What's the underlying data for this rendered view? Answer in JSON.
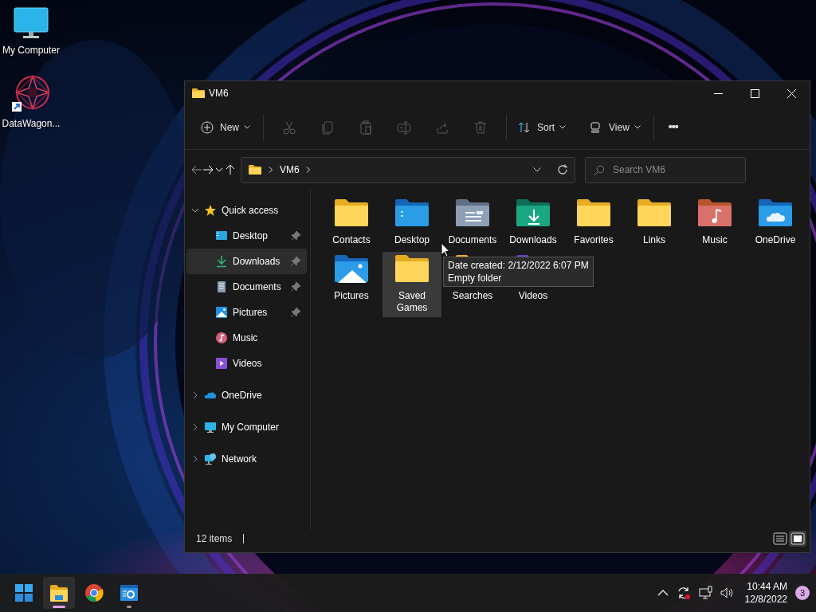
{
  "desktop_icons": [
    {
      "label": "My Computer",
      "kind": "computer"
    },
    {
      "label": "DataWagon...",
      "kind": "shortcut"
    }
  ],
  "window": {
    "title": "VM6"
  },
  "toolbar": [
    {
      "kind": "new",
      "label": "New",
      "disabled": false
    },
    {
      "kind": "cut",
      "disabled": true
    },
    {
      "kind": "copy",
      "disabled": true
    },
    {
      "kind": "paste",
      "disabled": true
    },
    {
      "kind": "rename",
      "disabled": true
    },
    {
      "kind": "share",
      "disabled": true
    },
    {
      "kind": "delete",
      "disabled": true
    },
    {
      "kind": "sort",
      "label": "Sort",
      "disabled": false
    },
    {
      "kind": "view",
      "label": "View",
      "disabled": false
    },
    {
      "kind": "more",
      "label": "•••",
      "disabled": false
    }
  ],
  "address_bar": {
    "path": [
      "VM6"
    ]
  },
  "search": {
    "placeholder": "Search VM6"
  },
  "sidebar": {
    "items": [
      {
        "label": "Quick access",
        "kind": "star",
        "expanded": true,
        "children": [
          {
            "label": "Desktop",
            "kind": "desktop",
            "pinned": true,
            "selected": false
          },
          {
            "label": "Downloads",
            "kind": "downloads",
            "pinned": true,
            "selected": true
          },
          {
            "label": "Documents",
            "kind": "documents",
            "pinned": true,
            "selected": false
          },
          {
            "label": "Pictures",
            "kind": "pictures",
            "pinned": true,
            "selected": false
          },
          {
            "label": "Music",
            "kind": "music",
            "pinned": false,
            "selected": false
          },
          {
            "label": "Videos",
            "kind": "videos",
            "pinned": false,
            "selected": false
          }
        ]
      },
      {
        "label": "OneDrive",
        "kind": "onedrive",
        "expanded": false
      },
      {
        "label": "My Computer",
        "kind": "computer",
        "expanded": false
      },
      {
        "label": "Network",
        "kind": "network",
        "expanded": false
      }
    ]
  },
  "folders": [
    {
      "label": "Contacts",
      "kind": "plain",
      "selected": false
    },
    {
      "label": "Desktop",
      "kind": "desktop",
      "selected": false
    },
    {
      "label": "Documents",
      "kind": "documents",
      "selected": false
    },
    {
      "label": "Downloads",
      "kind": "downloads",
      "selected": false
    },
    {
      "label": "Favorites",
      "kind": "plain",
      "selected": false
    },
    {
      "label": "Links",
      "kind": "plain",
      "selected": false
    },
    {
      "label": "Music",
      "kind": "music",
      "selected": false
    },
    {
      "label": "OneDrive",
      "kind": "onedrive",
      "selected": false
    },
    {
      "label": "Pictures",
      "kind": "pictures",
      "selected": false
    },
    {
      "label": "Saved Games",
      "kind": "plain",
      "selected": true
    },
    {
      "label": "Searches",
      "kind": "plain",
      "selected": false
    },
    {
      "label": "Videos",
      "kind": "videos",
      "selected": false
    }
  ],
  "tooltip": {
    "lines": [
      "Date created: 2/12/2022 6:07 PM",
      "Empty folder"
    ]
  },
  "status_bar": {
    "item_count": "12 items",
    "view_modes": [
      {
        "kind": "details",
        "selected": false
      },
      {
        "kind": "large_icons",
        "selected": true
      }
    ]
  },
  "taskbar": {
    "apps": [
      {
        "kind": "start",
        "running": false,
        "active": false
      },
      {
        "kind": "explorer",
        "running": true,
        "active": true
      },
      {
        "kind": "chrome",
        "running": false,
        "active": false
      },
      {
        "kind": "tool",
        "running": true,
        "active": false
      }
    ],
    "clock": {
      "time": "10:44 AM",
      "date": "12/8/2022"
    },
    "notification_count": "3"
  }
}
